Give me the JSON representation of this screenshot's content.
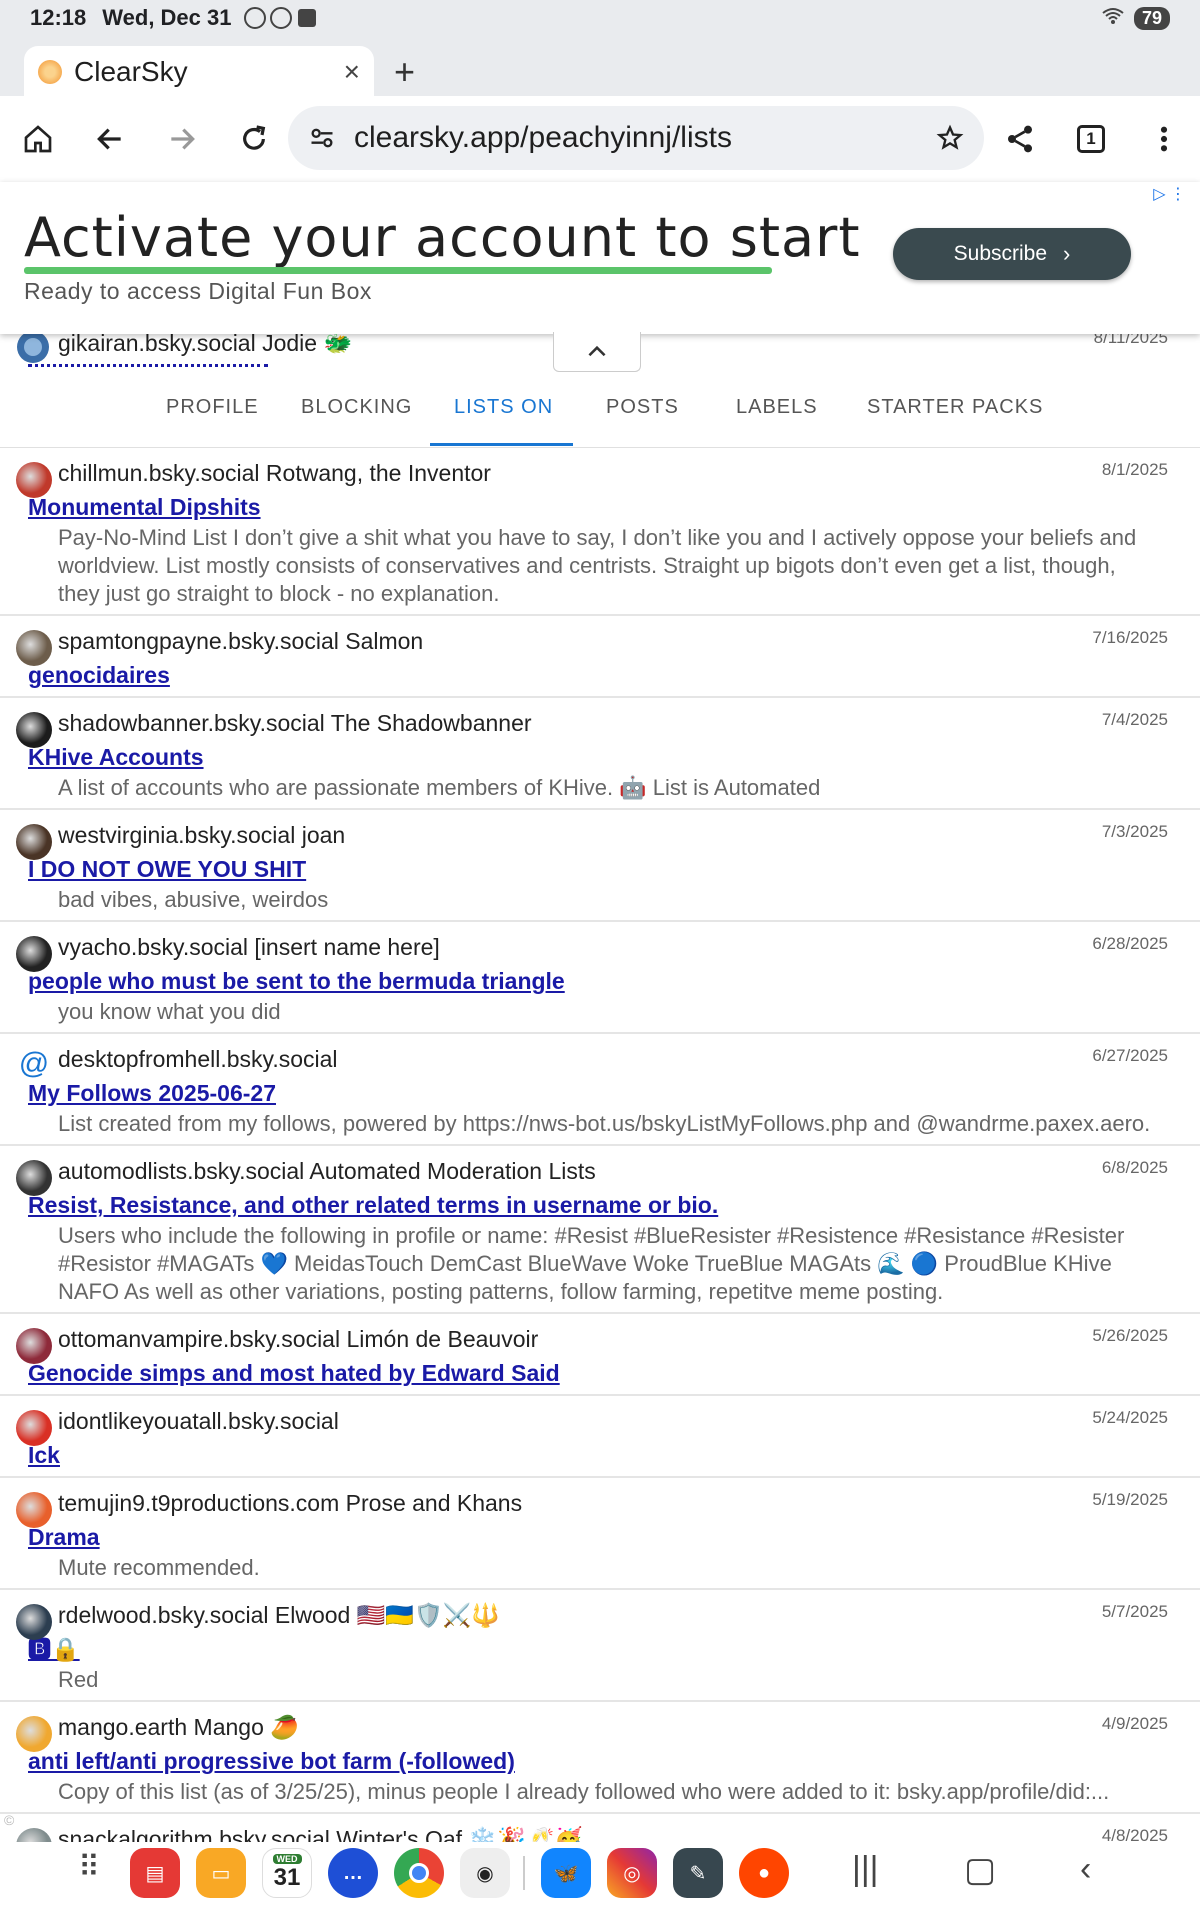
{
  "status_bar": {
    "time": "12:18",
    "date": "Wed, Dec 31",
    "battery": "79"
  },
  "browser": {
    "tab_title": "ClearSky",
    "tab_close": "×",
    "new_tab": "+",
    "url": "clearsky.app/peachyinnj/lists",
    "tab_count": "1"
  },
  "ad": {
    "headline": "Activate your account to start",
    "subline": "Ready to access Digital Fun Box",
    "cta": "Subscribe"
  },
  "profile_peek": {
    "handle": "gikairan.bsky.social Jodie 🐲",
    "date": "8/11/2025"
  },
  "tabs": [
    {
      "label": "PROFILE",
      "active": false
    },
    {
      "label": "BLOCKING",
      "active": false
    },
    {
      "label": "LISTS ON",
      "active": true
    },
    {
      "label": "POSTS",
      "active": false
    },
    {
      "label": "LABELS",
      "active": false
    },
    {
      "label": "STARTER PACKS",
      "active": false
    }
  ],
  "lists": [
    {
      "user": "chillmun.bsky.social Rotwang, the Inventor",
      "date": "8/1/2025",
      "list_name": "Monumental Dipshits",
      "description": "Pay-No-Mind List I don’t give a shit what you have to say, I don’t like you and I actively oppose your beliefs and worldview. List mostly consists of conservatives and centrists. Straight up bigots don’t even get a list, though, they just go straight to block - no explanation.",
      "avatar_color": "#c0392b"
    },
    {
      "user": "spamtongpayne.bsky.social Salmon",
      "date": "7/16/2025",
      "list_name": "genocidaires",
      "description": "",
      "avatar_color": "#6d5d4b"
    },
    {
      "user": "shadowbanner.bsky.social The Shadowbanner",
      "date": "7/4/2025",
      "list_name": "KHive Accounts",
      "description": "A list of accounts who are passionate members of KHive. 🤖 List is Automated",
      "avatar_color": "#1c1c1c"
    },
    {
      "user": "westvirginia.bsky.social joan",
      "date": "7/3/2025",
      "list_name": "I DO NOT OWE YOU SHIT",
      "description": "bad vibes, abusive, weirdos",
      "avatar_color": "#4a3426"
    },
    {
      "user": "vyacho.bsky.social [insert name here]",
      "date": "6/28/2025",
      "list_name": "people who must be sent to the bermuda triangle",
      "description": "you know what you did",
      "avatar_color": "#222222"
    },
    {
      "user": "desktopfromhell.bsky.social",
      "date": "6/27/2025",
      "list_name": "My Follows 2025-06-27",
      "description": "List created from my follows, powered by https://nws-bot.us/bskyListMyFollows.php and @wandrme.paxex.aero.",
      "avatar_color": "at"
    },
    {
      "user": "automodlists.bsky.social Automated Moderation Lists",
      "date": "6/8/2025",
      "list_name": "Resist, Resistance, and other related terms in username or bio.",
      "description": "Users who include the following in profile or name: #Resist #BlueResister #Resistence #Resistance #Resister #Resistor #MAGATs 💙 MeidasTouch DemCast BlueWave Woke TrueBlue MAGAts 🌊 🔵 ProudBlue KHive NAFO As well as other variations, posting patterns, follow farming, repetitve meme posting.",
      "avatar_color": "#333333"
    },
    {
      "user": "ottomanvampire.bsky.social Limón de Beauvoir",
      "date": "5/26/2025",
      "list_name": "Genocide simps and most hated by Edward Said",
      "description": "",
      "avatar_color": "#8e2a3a"
    },
    {
      "user": "idontlikeyouatall.bsky.social",
      "date": "5/24/2025",
      "list_name": "Ick",
      "description": "",
      "avatar_color": "#d93025"
    },
    {
      "user": "temujin9.t9productions.com Prose and Khans",
      "date": "5/19/2025",
      "list_name": "Drama",
      "description": "Mute recommended.",
      "avatar_color": "#e8602c"
    },
    {
      "user": "rdelwood.bsky.social Elwood 🇺🇸🇺🇦🛡️⚔️🔱",
      "date": "5/7/2025",
      "list_name": "🅱🔒",
      "description": "Red",
      "avatar_color": "#2c3e50"
    },
    {
      "user": "mango.earth Mango 🥭",
      "date": "4/9/2025",
      "list_name": "anti left/anti progressive bot farm (-followed)",
      "description": "Copy of this list (as of 3/25/25), minus people I already followed who were added to it: bsky.app/profile/did:...",
      "avatar_color": "#f0a830"
    },
    {
      "user": "snackalgorithm.bsky.social Winter's Oaf ❄️🎉🥂🥳",
      "date": "4/8/2025",
      "list_name": "",
      "description": "",
      "avatar_color": "#7f8c8d"
    }
  ],
  "dock": {
    "calendar_day": "31",
    "calendar_weekday": "WED"
  },
  "colors": {
    "link": "#1a1aa6",
    "active_tab": "#1976d2",
    "ad_button": "#3a4a4f",
    "ad_underline": "#5bc46a"
  }
}
